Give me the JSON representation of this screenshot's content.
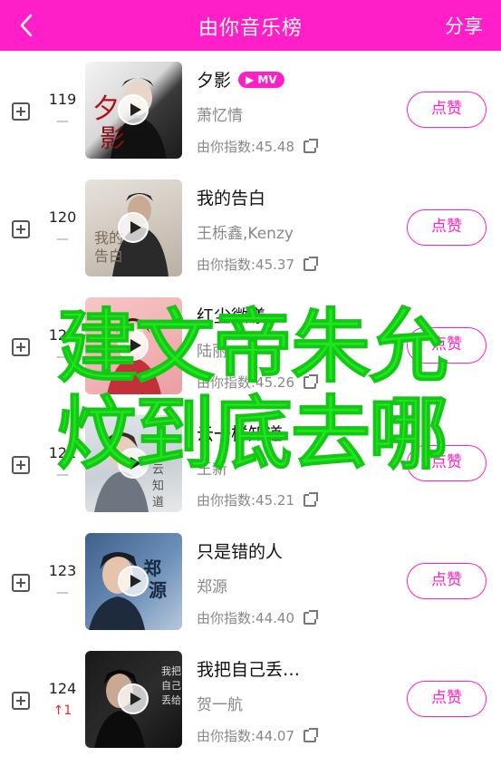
{
  "header": {
    "back_icon": "chevron-left-icon",
    "title": "由你音乐榜",
    "share": "分享",
    "color": "#ff1fc8"
  },
  "songs": [
    {
      "rank": "119",
      "trend": "—",
      "trend_type": "none",
      "title": "夕影",
      "mv": "▶ MV",
      "artist": "萧忆情",
      "index": "由你指数:45.48",
      "like": "点赞"
    },
    {
      "rank": "120",
      "trend": "—",
      "trend_type": "none",
      "title": "我的告白",
      "mv": "",
      "artist": "王栎鑫,Kenzy",
      "index": "由你指数:45.37",
      "like": "点赞"
    },
    {
      "rank": "121",
      "trend": "—",
      "trend_type": "none",
      "title": "红尘微漾",
      "mv": "",
      "artist": "陆丽",
      "index": "由你指数:45.26",
      "like": "点赞"
    },
    {
      "rank": "122",
      "trend": "—",
      "trend_type": "none",
      "title": "云一样知道",
      "mv": "",
      "artist": "王新",
      "index": "由你指数:45.21",
      "like": "点赞"
    },
    {
      "rank": "123",
      "trend": "—",
      "trend_type": "none",
      "title": "只是错的人",
      "mv": "",
      "artist": "郑源",
      "index": "由你指数:44.40",
      "like": "点赞"
    },
    {
      "rank": "124",
      "trend": "↑1",
      "trend_type": "up",
      "title": "我把自己丢…",
      "mv": "",
      "artist": "贺一航",
      "index": "由你指数:44.07",
      "like": "点赞"
    }
  ],
  "overlay": {
    "line1": "建文帝朱允",
    "line2": "炆到底去哪"
  },
  "colors": {
    "accent": "#ff1fc8",
    "overlay_text": "#1de81d",
    "trend_up": "#f0232d"
  }
}
